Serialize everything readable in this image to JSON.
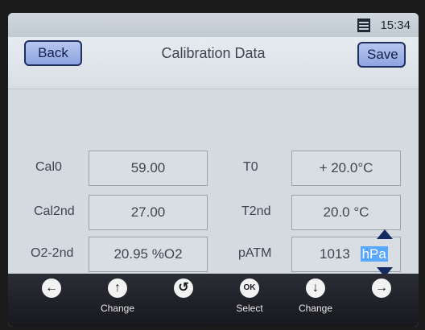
{
  "status": {
    "time": "15:34",
    "battery_icon": "battery-icon"
  },
  "header": {
    "back_label": "Back",
    "title": "Calibration Data",
    "save_label": "Save"
  },
  "fields": {
    "cal0": {
      "label": "Cal0",
      "value": "59.00"
    },
    "cal2nd": {
      "label": "Cal2nd",
      "value": "27.00"
    },
    "o2_2nd": {
      "label": "O2-2nd",
      "value": "20.95 %O2"
    },
    "t0": {
      "label": "T0",
      "value": "+ 20.0°C"
    },
    "t2nd": {
      "label": "T2nd",
      "value": "20.0 °C"
    },
    "patm": {
      "label": "pATM",
      "value": "1013",
      "unit": "hPa"
    }
  },
  "dock": [
    {
      "icon": "left-arrow-icon",
      "symbol": "←",
      "label": ""
    },
    {
      "icon": "up-arrow-icon",
      "symbol": "↑",
      "label": "Change"
    },
    {
      "icon": "undo-icon",
      "symbol": "↺",
      "label": ""
    },
    {
      "icon": "ok-icon",
      "symbol": "OK",
      "label": "Select"
    },
    {
      "icon": "down-arrow-icon",
      "symbol": "↓",
      "label": "Change"
    },
    {
      "icon": "right-arrow-icon",
      "symbol": "→",
      "label": ""
    }
  ],
  "colors": {
    "accent_button": "#8ea4e0",
    "dock_bg": "#17181d",
    "selection": "#5aa7ff"
  }
}
